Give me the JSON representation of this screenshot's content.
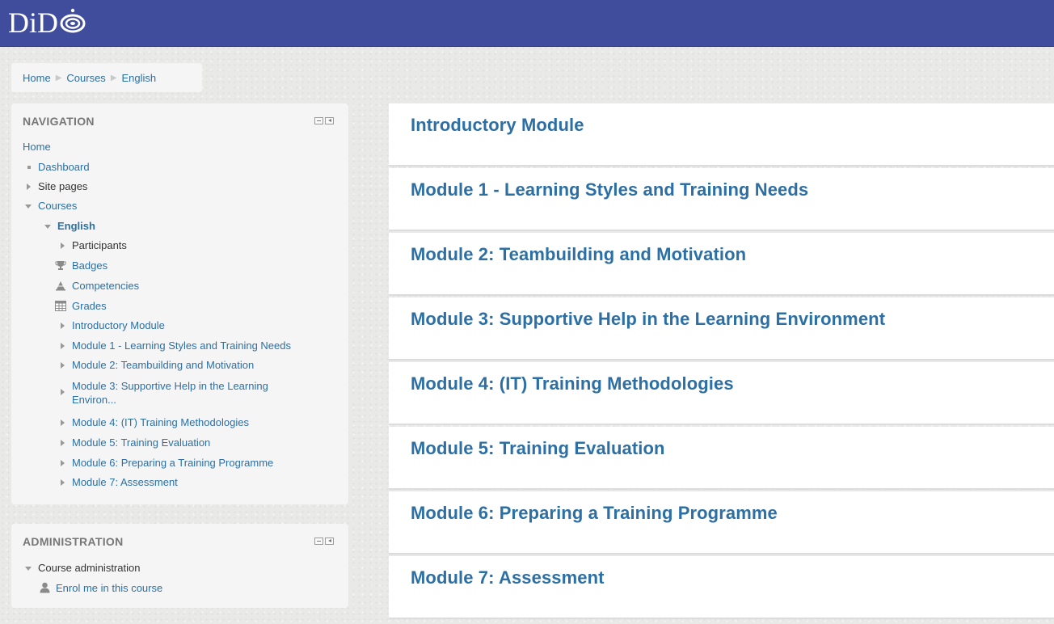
{
  "header": {
    "logo_text": "DiD",
    "bar_color": "#3f4d9c"
  },
  "breadcrumb": {
    "items": [
      "Home",
      "Courses",
      "English"
    ]
  },
  "navigation": {
    "title": "NAVIGATION",
    "home": "Home",
    "dashboard": "Dashboard",
    "site_pages": "Site pages",
    "courses": "Courses",
    "course": "English",
    "participants": "Participants",
    "badges": "Badges",
    "competencies": "Competencies",
    "grades": "Grades",
    "modules": [
      "Introductory Module",
      "Module 1 - Learning Styles and Training Needs",
      "Module 2: Teambuilding and Motivation",
      "Module 3: Supportive Help in the Learning Environ...",
      "Module 4: (IT) Training Methodologies",
      "Module 5: Training Evaluation",
      "Module 6: Preparing a Training Programme",
      "Module 7: Assessment"
    ]
  },
  "administration": {
    "title": "ADMINISTRATION",
    "course_admin": "Course administration",
    "enrol": "Enrol me in this course"
  },
  "sections": [
    "Introductory Module",
    "Module 1 - Learning Styles and Training Needs",
    "Module 2: Teambuilding and Motivation",
    "Module 3: Supportive Help in the Learning Environment",
    "Module 4: (IT) Training Methodologies",
    "Module 5: Training Evaluation",
    "Module 6: Preparing a Training Programme",
    "Module 7: Assessment"
  ],
  "colors": {
    "link": "#2c6fa5",
    "block_bg": "#f5f5f5"
  }
}
